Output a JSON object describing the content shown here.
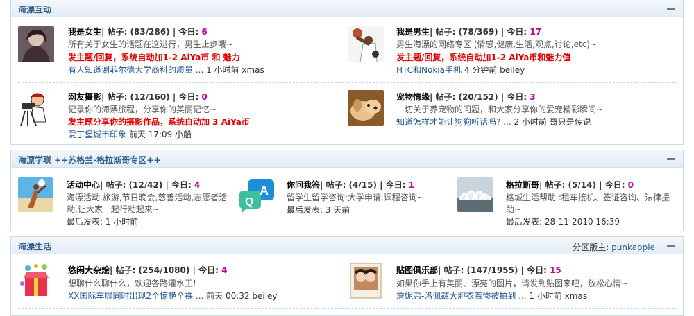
{
  "sections": [
    {
      "title": "海漂互动",
      "forums": [
        {
          "name": "我是女生",
          "stats": "| 帖子: (83/286) | 今日: ",
          "today": "6",
          "desc": "所有关于女生的话题在这进行，男生止步哦~",
          "promo": "发主题/回复，系统自动加1-2 AiYa币 和 魅力",
          "last_link": "有人知道谢菲尔德大学商科的质量 ...",
          "last_meta": " 1 小时前 xmas",
          "icon": "woman-avatar-icon"
        },
        {
          "name": "我是男生",
          "stats": "| 帖子: (78/369) | 今日: ",
          "today": "17",
          "desc": "男生海漂的网络专区 (情感,健康,生活,观点,讨论,etc)~",
          "promo": "发主题/回复，系统自动加1-2 AiYa币和魅力值",
          "last_link": "HTC和Nokia手机",
          "last_meta": " 4 分钟前 beiley",
          "icon": "basketball-player-icon"
        },
        {
          "name": "网友摄影",
          "stats": "| 帖子: (12/160) | 今日: ",
          "today": "0",
          "desc": "记录你的海漂旅程，分享你的美丽记忆~",
          "promo": "发主题分享你的摄影作品，系统自动加 3 AiYa币",
          "last_link": "爱丁堡城市印象",
          "last_meta": " 前天 17:09 小船",
          "icon": "photographer-cartoon-icon"
        },
        {
          "name": "宠物情缘",
          "stats": "| 帖子: (20/152) | 今日: ",
          "today": "3",
          "desc": "一切关于养宠物的问题，和大家分享你的爱宠精彩瞬间~",
          "promo": "",
          "last_link": "知道怎样才能让狗狗听话吗? ...",
          "last_meta": " 2 小时前 哥只是传说",
          "icon": "puppy-icon"
        }
      ]
    },
    {
      "title": "海漂学联 ++苏格兰-格拉斯哥专区++",
      "forums": [
        {
          "name": "活动中心",
          "stats": "| 帖子: (12/42) | 今日: ",
          "today": "4",
          "desc1": "海漂活动,旅游,节日晚会,慈善活动,志愿者活",
          "desc2": "动,让大家一起行动起来~",
          "last": "最后发表: 1 小时前",
          "icon": "beach-activity-icon"
        },
        {
          "name": "你问我答",
          "stats": "| 帖子: (4/15) | 今日: ",
          "today": "1",
          "desc1": "留学生留学咨询:大学申请,课程咨询~",
          "desc2": "",
          "last": "最后发表: 3 天前",
          "icon": "qa-bubbles-icon",
          "qa_letters": [
            "Q",
            "A"
          ]
        },
        {
          "name": "格拉斯哥",
          "stats": "| 帖子: (5/14) | 今日: ",
          "today": "0",
          "desc1": "格城生活帮助 :租车接机、签证咨询、法律援",
          "desc2": "助~",
          "last": "最后发表: 28-11-2010 16:39",
          "icon": "glasgow-armadillo-icon"
        }
      ]
    },
    {
      "title": "海漂生活",
      "moderator_label": "分区版主: ",
      "moderator": "punkapple",
      "forums": [
        {
          "name": "悠闲大杂烩",
          "stats": "| 帖子: (254/1080) | 今日: ",
          "today": "4",
          "desc": "想聊什么聊什么，欢迎各路灌水王!",
          "last_link": "XX国际车展同时出现2个惊艳全裸 ...",
          "last_meta": " 前天 00:32 beiley",
          "icon": "gift-box-icon"
        },
        {
          "name": "贴图俱乐部",
          "stats": "| 帖子: (147/1955) | 今日: ",
          "today": "15",
          "desc": "如果你手上有美丽、漂亮的图片，请发到贴图来吧，放松心情~",
          "last_link": "詹妮弗-洛佩兹大胆衣着惨被拍到 ...",
          "last_meta": " 1 小时前 xmas",
          "icon": "photo-frame-icon"
        }
      ]
    }
  ]
}
